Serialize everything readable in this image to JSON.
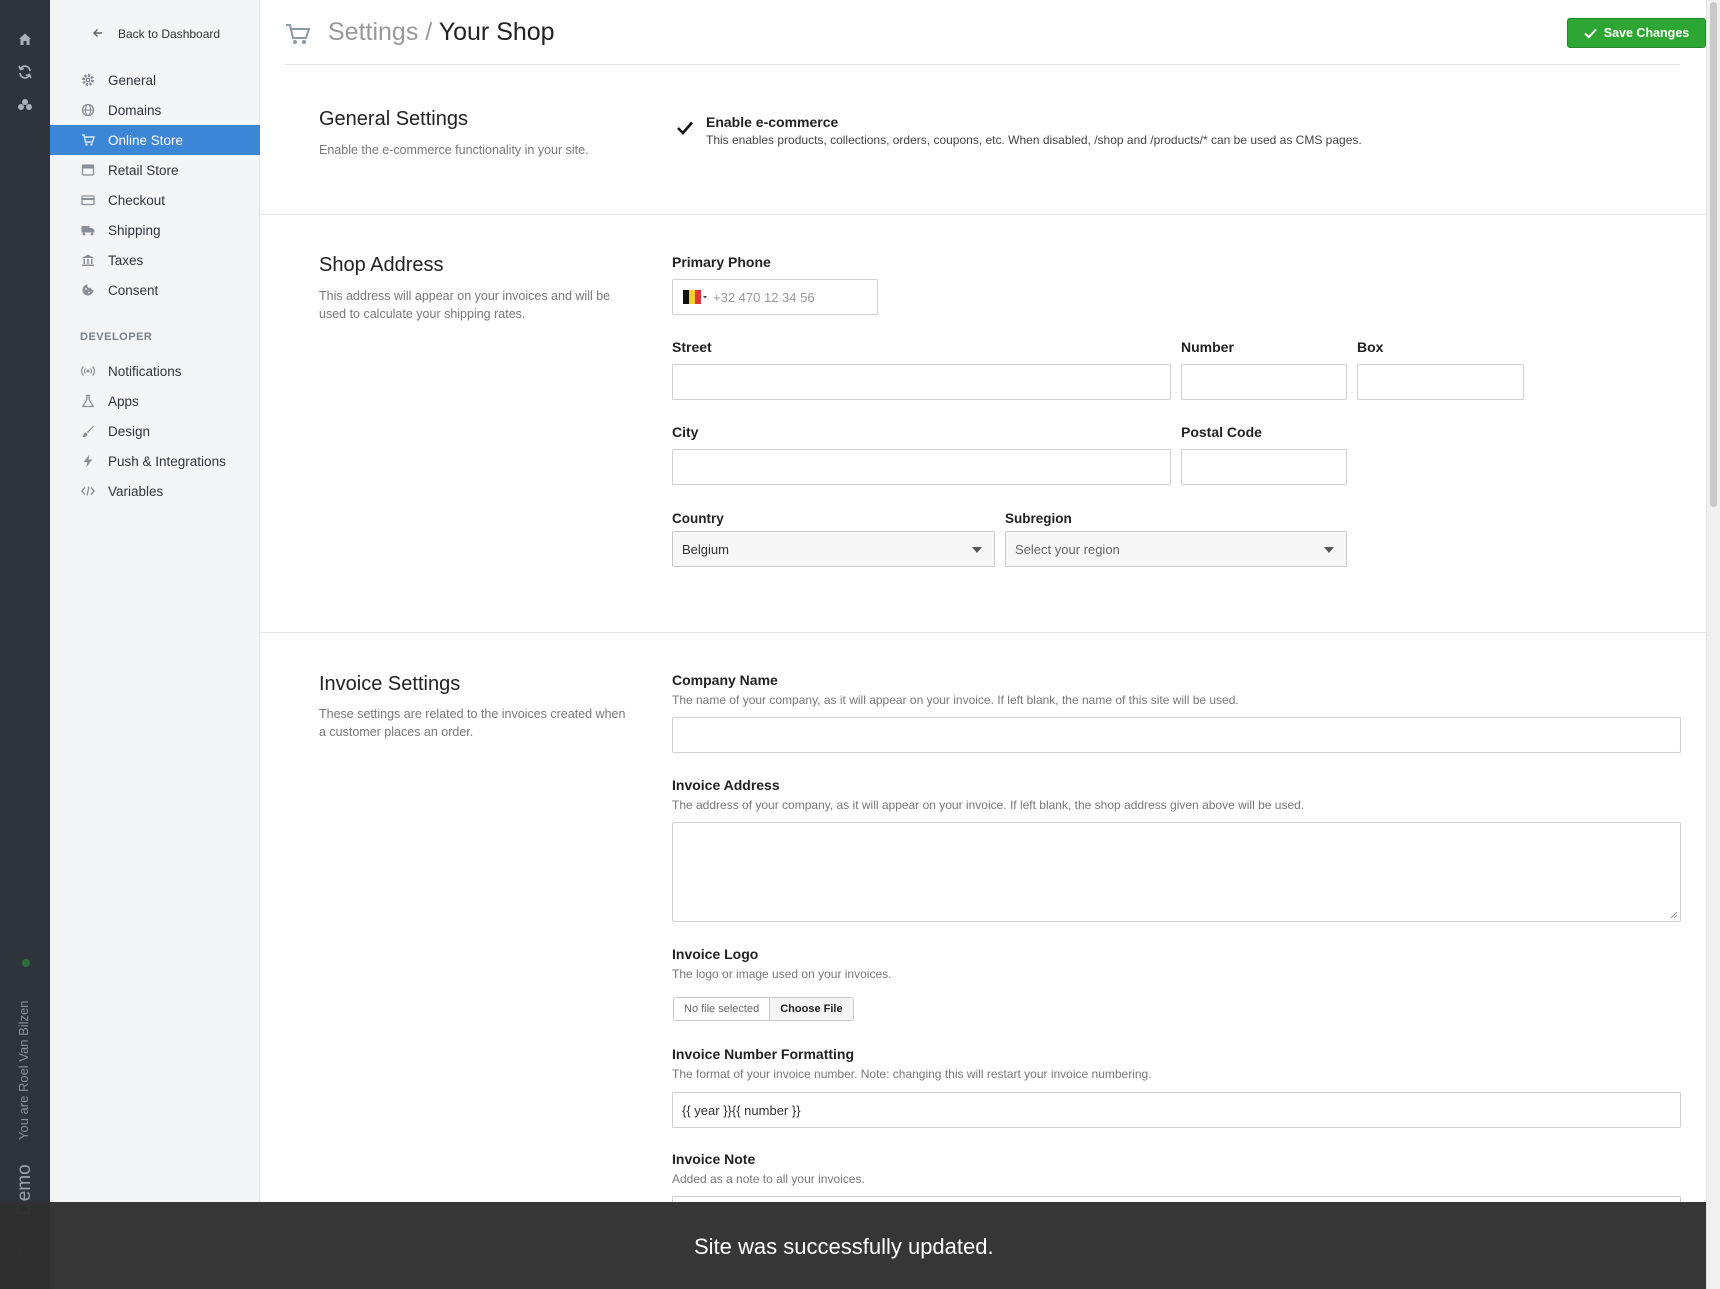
{
  "rail": {
    "icons": [
      "home-icon",
      "refresh-icon",
      "users-icon"
    ],
    "user_text": "You are Roel Van Bilzen",
    "env_label": "Demo"
  },
  "sidebar": {
    "back_label": "Back to Dashboard",
    "items": [
      {
        "label": "General",
        "icon": "gear-icon"
      },
      {
        "label": "Domains",
        "icon": "globe-icon"
      },
      {
        "label": "Online Store",
        "icon": "cart-icon",
        "active": true
      },
      {
        "label": "Retail Store",
        "icon": "store-icon"
      },
      {
        "label": "Checkout",
        "icon": "credit-card-icon"
      },
      {
        "label": "Shipping",
        "icon": "truck-icon"
      },
      {
        "label": "Taxes",
        "icon": "bank-icon"
      },
      {
        "label": "Consent",
        "icon": "cookie-icon"
      }
    ],
    "developer_heading": "DEVELOPER",
    "developer_items": [
      {
        "label": "Notifications",
        "icon": "broadcast-icon"
      },
      {
        "label": "Apps",
        "icon": "flask-icon"
      },
      {
        "label": "Design",
        "icon": "brush-icon"
      },
      {
        "label": "Push & Integrations",
        "icon": "bolt-icon"
      },
      {
        "label": "Variables",
        "icon": "code-icon"
      }
    ]
  },
  "header": {
    "crumb": "Settings /",
    "title": "Your Shop",
    "save_label": "Save Changes"
  },
  "general": {
    "title": "General Settings",
    "desc": "Enable the e-commerce functionality in your site.",
    "enable_label": "Enable e-commerce",
    "enable_checked": true,
    "enable_hint": "This enables products, collections, orders, coupons, etc. When disabled, /shop and /products/* can be used as CMS pages."
  },
  "address": {
    "title": "Shop Address",
    "desc": "This address will appear on your invoices and will be used to calculate your shipping rates.",
    "phone_label": "Primary Phone",
    "phone_placeholder": "+32 470 12 34 56",
    "street_label": "Street",
    "number_label": "Number",
    "box_label": "Box",
    "city_label": "City",
    "postal_label": "Postal Code",
    "country_label": "Country",
    "country_value": "Belgium",
    "subregion_label": "Subregion",
    "subregion_placeholder": "Select your region"
  },
  "invoice": {
    "title": "Invoice Settings",
    "desc": "These settings are related to the invoices created when a customer places an order.",
    "company_label": "Company Name",
    "company_hint": "The name of your company, as it will appear on your invoice. If left blank, the name of this site will be used.",
    "address_label": "Invoice Address",
    "address_hint": "The address of your company, as it will appear on your invoice. If left blank, the shop address given above will be used.",
    "logo_label": "Invoice Logo",
    "logo_hint": "The logo or image used on your invoices.",
    "file_none": "No file selected",
    "file_choose": "Choose File",
    "number_label": "Invoice Number Formatting",
    "number_hint": "The format of your invoice number. Note: changing this will restart your invoice numbering.",
    "number_value": "{{ year }}{{ number }}",
    "note_label": "Invoice Note",
    "note_hint": "Added as a note to all your invoices."
  },
  "toast": {
    "message": "Site was successfully updated."
  },
  "colors": {
    "accent": "#3b86d6",
    "save": "#2ea633",
    "rail": "#2f343c"
  }
}
